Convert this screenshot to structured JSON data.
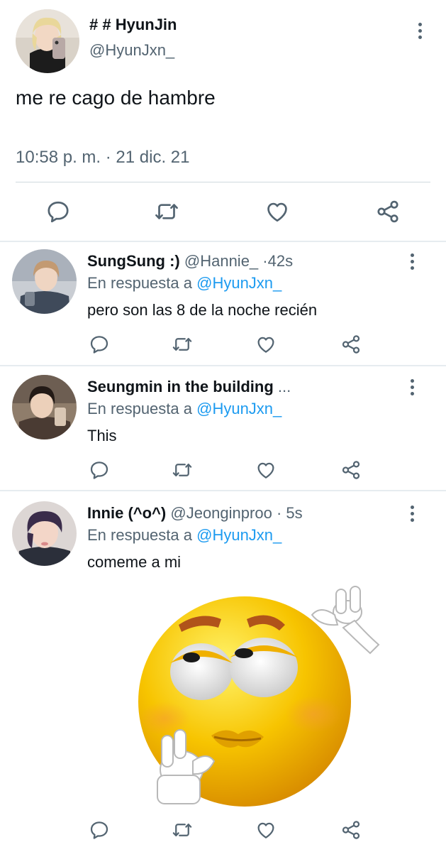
{
  "main_tweet": {
    "display_name": "# # HyunJin",
    "handle": "@HyunJxn_",
    "text": "me re cago de hambre",
    "timestamp": "10:58 p. m. · 21 dic. 21",
    "avatar_icon": "profile-photo",
    "actions": [
      "reply-icon",
      "retweet-icon",
      "like-icon",
      "share-icon"
    ]
  },
  "replies": [
    {
      "display_name": "SungSung :)",
      "handle": "@Hannie_",
      "dot": "·",
      "age": "42s",
      "in_reply_prefix": "En respuesta a",
      "in_reply_to": "@HyunJxn_",
      "text": "pero son las 8 de la noche recién"
    },
    {
      "display_name": "Seungmin in the building",
      "ellipsis": "...",
      "in_reply_prefix": "En respuesta a",
      "in_reply_to": "@HyunJxn_",
      "text": "This"
    },
    {
      "display_name": "Innie (^o^)",
      "handle": "@Jeonginproo",
      "dot": "·",
      "age": "5s",
      "in_reply_prefix": "En respuesta a",
      "in_reply_to": "@HyunJxn_",
      "text": "comeme a mi",
      "media_icon": "thinking-emoji-image"
    }
  ],
  "colors": {
    "text": "#0f1419",
    "muted": "#536471",
    "link": "#1d9bf0",
    "divider": "#e6ecf0",
    "emoji_yellow": "#f7c400"
  }
}
